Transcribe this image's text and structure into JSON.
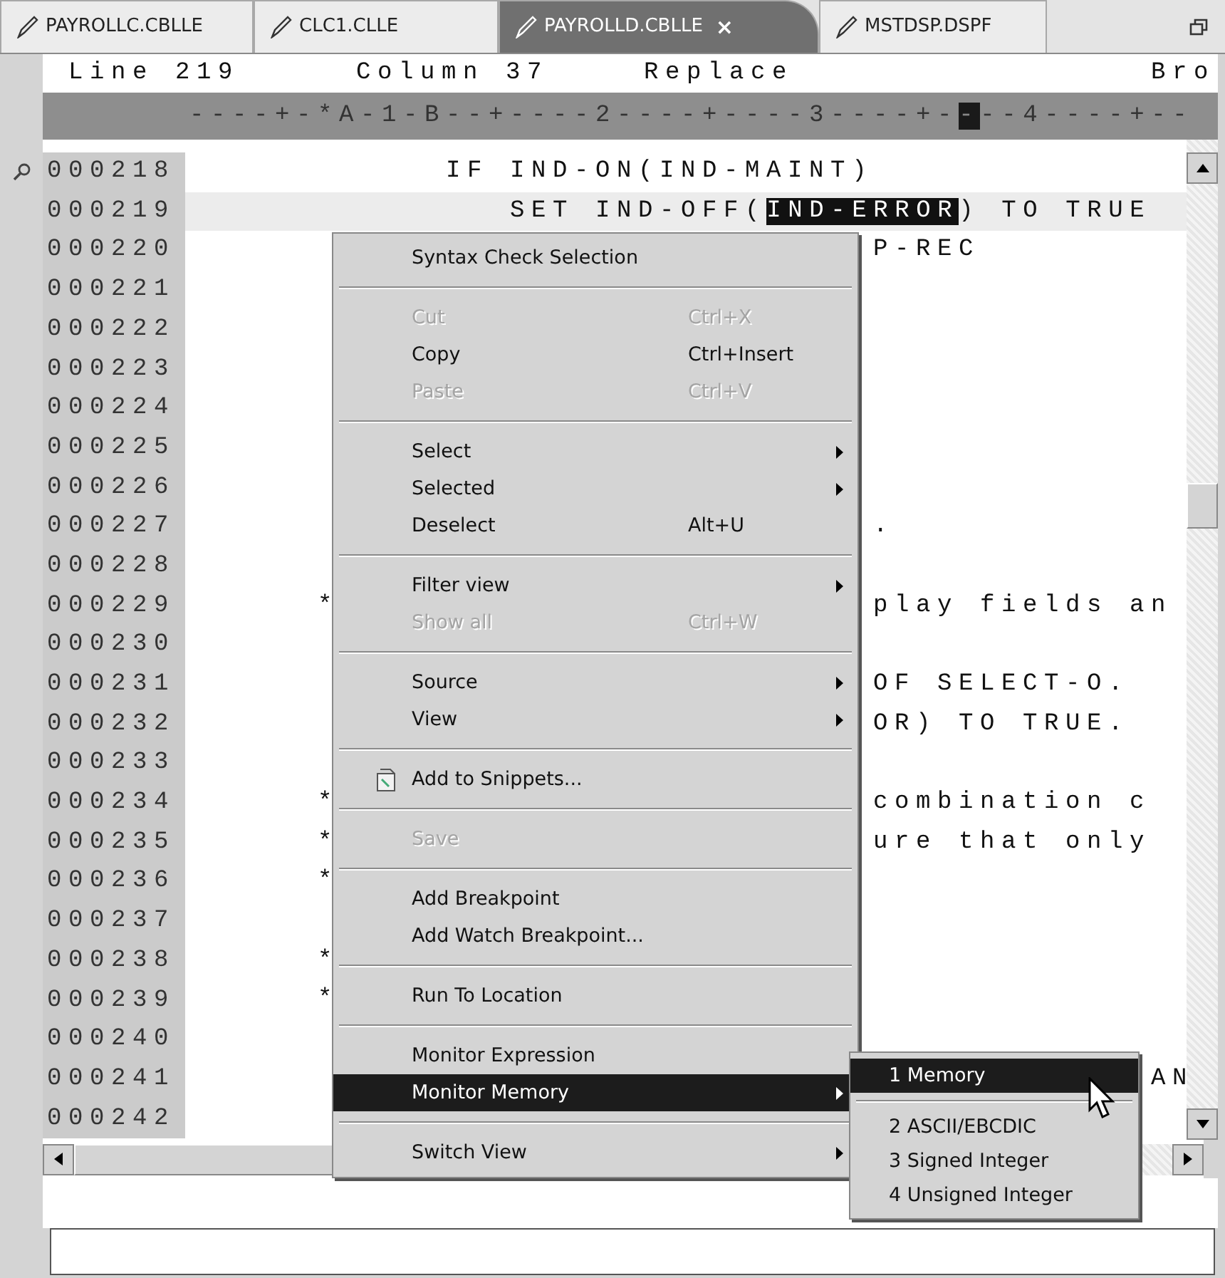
{
  "tabs": [
    {
      "label": "PAYROLLC.CBLLE",
      "selected": false
    },
    {
      "label": "CLC1.CLLE",
      "selected": false
    },
    {
      "label": "PAYROLLD.CBLLE",
      "selected": true,
      "close": "×"
    },
    {
      "label": "MSTDSP.DSPF",
      "selected": false
    }
  ],
  "status_line": {
    "line": "Line 219",
    "column": "Column 37",
    "mode": "Replace",
    "view": "Bro"
  },
  "ruler": {
    "before": "----+-*A-1-B--+----2----+----3----+-",
    "cursor": "-",
    "after": "--4----+--"
  },
  "lines": [
    {
      "number": "000218",
      "current": false,
      "annotated": true,
      "segments": [
        {
          "text": "            IF IND-ON(IND-MAINT)",
          "selected": false
        }
      ]
    },
    {
      "number": "000219",
      "current": true,
      "annotated": false,
      "segments": [
        {
          "text": "               SET IND-OFF(",
          "selected": false
        },
        {
          "text": "IND-ERROR",
          "selected": true
        },
        {
          "text": ") TO TRUE",
          "selected": false
        }
      ]
    },
    {
      "number": "000220",
      "current": false,
      "annotated": false,
      "right": "P-REC"
    },
    {
      "number": "000221",
      "current": false,
      "annotated": false
    },
    {
      "number": "000222",
      "current": false,
      "annotated": false
    },
    {
      "number": "000223",
      "current": false,
      "annotated": false
    },
    {
      "number": "000224",
      "current": false,
      "annotated": false
    },
    {
      "number": "000225",
      "current": false,
      "annotated": false
    },
    {
      "number": "000226",
      "current": false,
      "annotated": false
    },
    {
      "number": "000227",
      "current": false,
      "annotated": false,
      "right": "."
    },
    {
      "number": "000228",
      "current": false,
      "annotated": false
    },
    {
      "number": "000229",
      "current": false,
      "annotated": false,
      "left": "      *",
      "right": "play fields an"
    },
    {
      "number": "000230",
      "current": false,
      "annotated": false
    },
    {
      "number": "000231",
      "current": false,
      "annotated": false,
      "right": "OF SELECT-O."
    },
    {
      "number": "000232",
      "current": false,
      "annotated": false,
      "right": "OR) TO TRUE."
    },
    {
      "number": "000233",
      "current": false,
      "annotated": false
    },
    {
      "number": "000234",
      "current": false,
      "annotated": false,
      "left": "      *",
      "right": "combination c"
    },
    {
      "number": "000235",
      "current": false,
      "annotated": false,
      "left": "      *",
      "right": "ure that only"
    },
    {
      "number": "000236",
      "current": false,
      "annotated": false,
      "left": "      *"
    },
    {
      "number": "000237",
      "current": false,
      "annotated": false
    },
    {
      "number": "000238",
      "current": false,
      "annotated": false,
      "left": "      *"
    },
    {
      "number": "000239",
      "current": false,
      "annotated": false,
      "left": "      *"
    },
    {
      "number": "000240",
      "current": false,
      "annotated": false
    },
    {
      "number": "000241",
      "current": false,
      "annotated": false,
      "right": "             AN"
    },
    {
      "number": "000242",
      "current": false,
      "annotated": false
    }
  ],
  "context_menu": {
    "items": [
      {
        "kind": "item",
        "label": "Syntax Check Selection",
        "disabled": false,
        "selected": false,
        "submenu": false
      },
      {
        "kind": "separator"
      },
      {
        "kind": "item",
        "label": "Cut",
        "shortcut": "Ctrl+X",
        "disabled": true,
        "selected": false,
        "submenu": false
      },
      {
        "kind": "item",
        "label": "Copy",
        "shortcut": "Ctrl+Insert",
        "disabled": false,
        "selected": false,
        "submenu": false
      },
      {
        "kind": "item",
        "label": "Paste",
        "shortcut": "Ctrl+V",
        "disabled": true,
        "selected": false,
        "submenu": false
      },
      {
        "kind": "separator"
      },
      {
        "kind": "item",
        "label": "Select",
        "disabled": false,
        "selected": false,
        "submenu": true
      },
      {
        "kind": "item",
        "label": "Selected",
        "disabled": false,
        "selected": false,
        "submenu": true
      },
      {
        "kind": "item",
        "label": "Deselect",
        "shortcut": "Alt+U",
        "disabled": false,
        "selected": false,
        "submenu": false
      },
      {
        "kind": "separator"
      },
      {
        "kind": "item",
        "label": "Filter view",
        "disabled": false,
        "selected": false,
        "submenu": true
      },
      {
        "kind": "item",
        "label": "Show all",
        "shortcut": "Ctrl+W",
        "disabled": true,
        "selected": false,
        "submenu": false
      },
      {
        "kind": "separator"
      },
      {
        "kind": "item",
        "label": "Source",
        "disabled": false,
        "selected": false,
        "submenu": true
      },
      {
        "kind": "item",
        "label": "View",
        "disabled": false,
        "selected": false,
        "submenu": true
      },
      {
        "kind": "separator"
      },
      {
        "kind": "iconitem",
        "label": "Add to Snippets...",
        "disabled": false,
        "selected": false,
        "submenu": false
      },
      {
        "kind": "separator"
      },
      {
        "kind": "item",
        "label": "Save",
        "disabled": true,
        "selected": false,
        "submenu": false
      },
      {
        "kind": "separator"
      },
      {
        "kind": "item",
        "label": "Add Breakpoint",
        "disabled": false,
        "selected": false,
        "submenu": false
      },
      {
        "kind": "item",
        "label": "Add Watch Breakpoint...",
        "disabled": false,
        "selected": false,
        "submenu": false
      },
      {
        "kind": "separator"
      },
      {
        "kind": "item",
        "label": "Run To Location",
        "disabled": false,
        "selected": false,
        "submenu": false
      },
      {
        "kind": "separator"
      },
      {
        "kind": "item",
        "label": "Monitor Expression",
        "disabled": false,
        "selected": false,
        "submenu": false
      },
      {
        "kind": "item",
        "label": "Monitor Memory",
        "disabled": false,
        "selected": true,
        "submenu": true
      },
      {
        "kind": "separator"
      },
      {
        "kind": "item",
        "label": "Switch View",
        "disabled": false,
        "selected": false,
        "submenu": true
      }
    ]
  },
  "submenu": {
    "items": [
      {
        "kind": "item",
        "label": "1 Memory",
        "disabled": false,
        "selected": true,
        "submenu": false
      },
      {
        "kind": "separator"
      },
      {
        "kind": "item",
        "label": "2 ASCII/EBCDIC",
        "disabled": false,
        "selected": false,
        "submenu": false
      },
      {
        "kind": "item",
        "label": "3 Signed Integer",
        "disabled": false,
        "selected": false,
        "submenu": false
      },
      {
        "kind": "item",
        "label": "4 Unsigned Integer",
        "disabled": false,
        "selected": false,
        "submenu": false
      }
    ]
  }
}
